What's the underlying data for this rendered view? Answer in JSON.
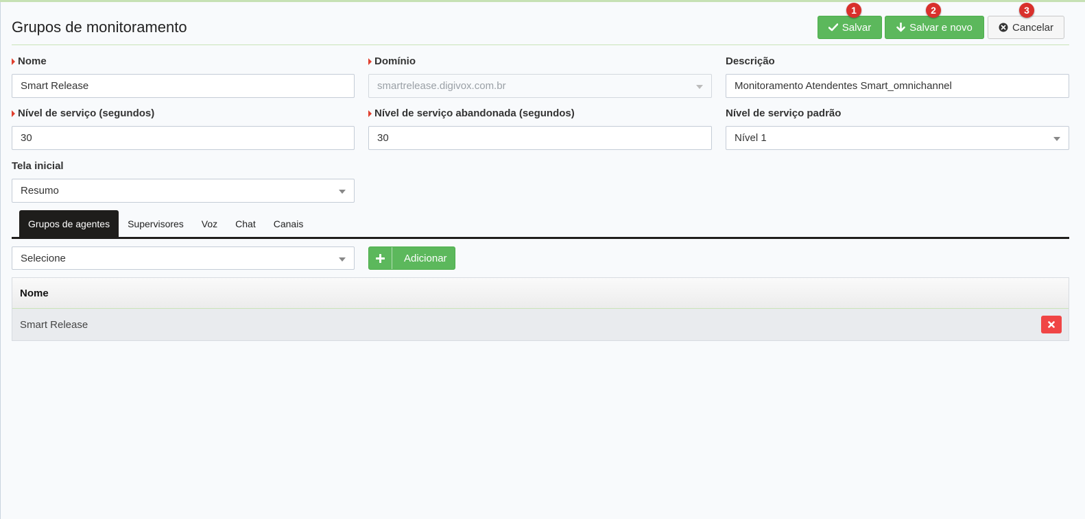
{
  "page": {
    "title": "Grupos de monitoramento"
  },
  "toolbar": {
    "save_label": "Salvar",
    "save_new_label": "Salvar e novo",
    "cancel_label": "Cancelar",
    "badges": [
      "1",
      "2",
      "3"
    ],
    "colors": {
      "green": "#5cb85c",
      "badge": "#d9302c"
    }
  },
  "form": {
    "nome": {
      "label": "Nome",
      "value": "Smart Release"
    },
    "dominio": {
      "label": "Domínio",
      "value": "smartrelease.digivox.com.br"
    },
    "descricao": {
      "label": "Descrição",
      "value": "Monitoramento Atendentes Smart_omnichannel"
    },
    "nivel_servico": {
      "label": "Nível de serviço (segundos)",
      "value": "30"
    },
    "nivel_abandonada": {
      "label": "Nível de serviço abandonada (segundos)",
      "value": "30"
    },
    "nivel_padrao": {
      "label": "Nível de serviço padrão",
      "value": "Nível 1"
    },
    "tela_inicial": {
      "label": "Tela inicial",
      "value": "Resumo"
    }
  },
  "tabs": [
    {
      "label": "Grupos de agentes",
      "active": true
    },
    {
      "label": "Supervisores",
      "active": false
    },
    {
      "label": "Voz",
      "active": false
    },
    {
      "label": "Chat",
      "active": false
    },
    {
      "label": "Canais",
      "active": false
    }
  ],
  "agent_groups": {
    "select_value": "Selecione",
    "add_label": "Adicionar",
    "table": {
      "header": "Nome",
      "rows": [
        {
          "nome": "Smart Release"
        }
      ]
    }
  }
}
